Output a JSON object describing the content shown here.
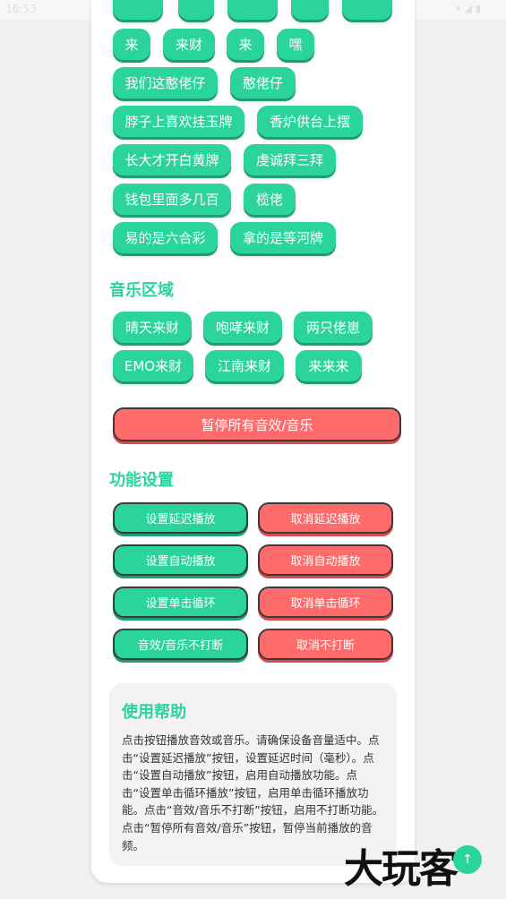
{
  "status_bar": {
    "time": "16:53",
    "icons": "▾◢▮"
  },
  "sound_buttons_cut": [
    "",
    "",
    "",
    "",
    ""
  ],
  "sound_buttons": [
    [
      "来",
      "来财",
      "来",
      "嘿"
    ],
    [
      "我们这憨佬仔",
      "憨佬仔"
    ],
    [
      "脖子上喜欢挂玉牌",
      "香炉供台上摆"
    ],
    [
      "长大才开白黄牌",
      "虔诚拜三拜"
    ],
    [
      "钱包里面多几百",
      "榄佬"
    ],
    [
      "易的是六合彩",
      "拿的是等河牌"
    ]
  ],
  "music_section": {
    "title": "音乐区域",
    "rows": [
      [
        "晴天来财",
        "咆哮来财",
        "两只佬崽"
      ],
      [
        "EMO来财",
        "江南来财",
        "来来来"
      ]
    ]
  },
  "stop_all": "暂停所有音效/音乐",
  "settings_section": {
    "title": "功能设置",
    "rows": [
      [
        "设置延迟播放",
        "取消延迟播放"
      ],
      [
        "设置自动播放",
        "取消自动播放"
      ],
      [
        "设置单击循环",
        "取消单击循环"
      ],
      [
        "音效/音乐不打断",
        "取消不打断"
      ]
    ]
  },
  "help": {
    "title": "使用帮助",
    "text": "点击按钮播放音效或音乐。请确保设备音量适中。点击“设置延迟播放”按钮，设置延迟时间（毫秒）。点击“设置自动播放”按钮，启用自动播放功能。点击“设置单击循环播放”按钮，启用单击循环播放功能。点击“音效/音乐不打断”按钮，启用不打断功能。点击“暂停所有音效/音乐”按钮，暂停当前播放的音频。"
  },
  "watermark": "大玩客",
  "fab_icon": "arrow-up-icon",
  "colors": {
    "accent": "#2ad49b",
    "danger": "#ff6b6b",
    "card": "#ffffff",
    "help_bg": "#f3f3f3"
  }
}
